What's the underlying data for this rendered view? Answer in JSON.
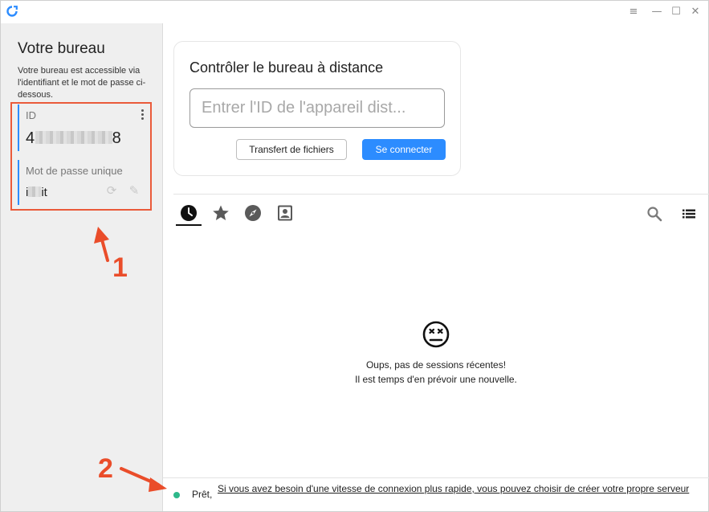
{
  "window": {
    "controls": {
      "menu": "≡",
      "minimize": "—",
      "maximize": "☐",
      "close": "✕"
    }
  },
  "left_panel": {
    "title": "Votre bureau",
    "description": "Votre bureau est accessible via l'identifiant et le mot de passe ci-dessous.",
    "id_label": "ID",
    "id_prefix": "4",
    "id_suffix": "8",
    "password_label": "Mot de passe unique",
    "password_prefix": "i",
    "password_suffix": "it"
  },
  "connect_card": {
    "title": "Contrôler le bureau à distance",
    "input_placeholder": "Entrer l'ID de l'appareil dist...",
    "transfer_button": "Transfert de fichiers",
    "connect_button": "Se connecter"
  },
  "tabs": [
    "recent-sessions",
    "favorites",
    "discovered",
    "address-book"
  ],
  "empty_state": {
    "line1": "Oups, pas de sessions récentes!",
    "line2": "Il est temps d'en prévoir une nouvelle."
  },
  "status": {
    "ready": "Prêt,",
    "link": "Si vous avez besoin d'une vitesse de connexion plus rapide, vous pouvez choisir de créer votre propre serveur"
  },
  "annotations": {
    "label1": "1",
    "label2": "2"
  },
  "colors": {
    "accent": "#2c8cff",
    "annotation": "#ea4d2a",
    "status_ok": "#2eb88a"
  }
}
